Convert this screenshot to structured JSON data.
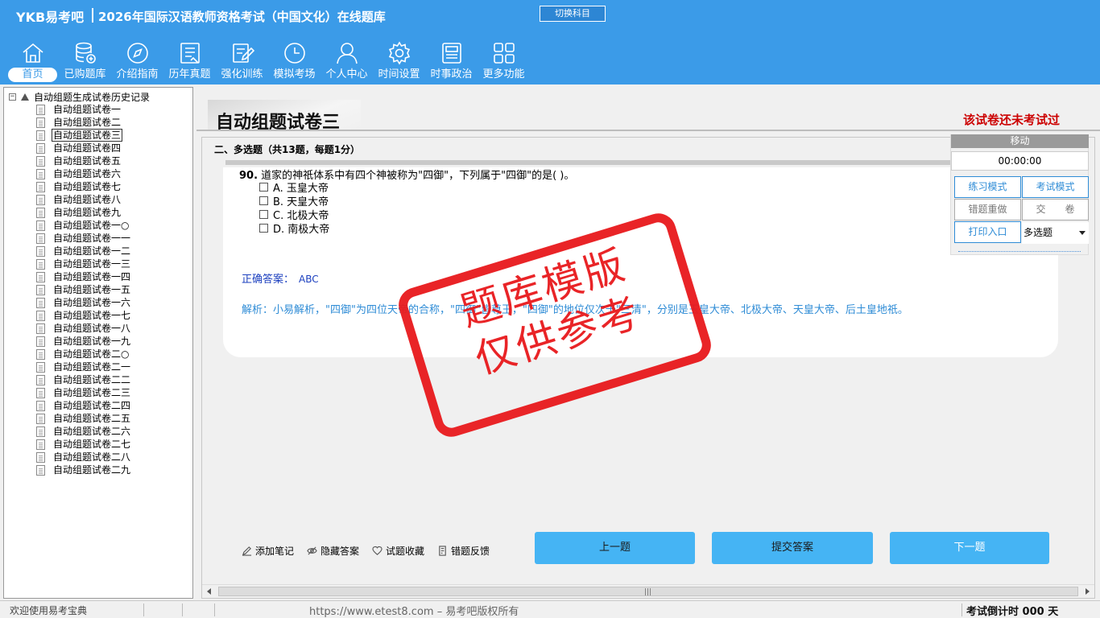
{
  "header": {
    "logo": "YKB易考吧",
    "title": "2026年国际汉语教师资格考试（中国文化）在线题库",
    "switch_subject": "切换科目"
  },
  "nav": [
    {
      "label": "首页",
      "icon": "home-icon",
      "active": true
    },
    {
      "label": "已购题库",
      "icon": "database-icon"
    },
    {
      "label": "介绍指南",
      "icon": "compass-icon"
    },
    {
      "label": "历年真题",
      "icon": "list-icon"
    },
    {
      "label": "强化训练",
      "icon": "edit-icon"
    },
    {
      "label": "模拟考场",
      "icon": "clock-icon"
    },
    {
      "label": "个人中心",
      "icon": "user-icon"
    },
    {
      "label": "时间设置",
      "icon": "gear-icon"
    },
    {
      "label": "时事政治",
      "icon": "news-icon"
    },
    {
      "label": "更多功能",
      "icon": "grid-icon"
    }
  ],
  "tree": {
    "root": "自动组题生成试卷历史记录",
    "expander": "−",
    "items": [
      "自动组题试卷一",
      "自动组题试卷二",
      "自动组题试卷三",
      "自动组题试卷四",
      "自动组题试卷五",
      "自动组题试卷六",
      "自动组题试卷七",
      "自动组题试卷八",
      "自动组题试卷九",
      "自动组题试卷一○",
      "自动组题试卷一一",
      "自动组题试卷一二",
      "自动组题试卷一三",
      "自动组题试卷一四",
      "自动组题试卷一五",
      "自动组题试卷一六",
      "自动组题试卷一七",
      "自动组题试卷一八",
      "自动组题试卷一九",
      "自动组题试卷二○",
      "自动组题试卷二一",
      "自动组题试卷二二",
      "自动组题试卷二三",
      "自动组题试卷二四",
      "自动组题试卷二五",
      "自动组题试卷二六",
      "自动组题试卷二七",
      "自动组题试卷二八",
      "自动组题试卷二九"
    ],
    "selected_index": 2
  },
  "paper": {
    "title": "自动组题试卷三",
    "status": "该试卷还未考试过",
    "section": "二、多选题（共13题，每题1分）"
  },
  "question": {
    "number": "90.",
    "text": "道家的神祇体系中有四个神被称为\"四御\"，下列属于\"四御\"的是( )。",
    "options": [
      "A. 玉皇大帝",
      "B. 天皇大帝",
      "C. 北极大帝",
      "D. 南极大帝"
    ],
    "answer_label": "正确答案：",
    "answer": "ABC",
    "analysis": "解析：小易解析，\"四御\"为四位天帝的合称，\"四御\"皆尊王，\"四御\"的地位仅次于\"三清\"，分别是玉皇大帝、北极大帝、天皇大帝、后土皇地祇。"
  },
  "stamp": {
    "line1": "题库模版",
    "line2": "仅供参考"
  },
  "side_panel": {
    "move": "移动",
    "timer": "00:00:00",
    "practice_mode": "练习模式",
    "exam_mode": "考试模式",
    "redo_wrong": "错题重做",
    "submit_paper": "交　　卷",
    "print": "打印入口",
    "question_type": "多选题"
  },
  "toolbar": {
    "add_note": "添加笔记",
    "hide_answer": "隐藏答案",
    "favorite": "试题收藏",
    "feedback": "错题反馈",
    "prev": "上一题",
    "submit": "提交答案",
    "next": "下一题"
  },
  "status_bar": {
    "welcome": "欢迎使用易考宝典",
    "copyright": "https://www.etest8.com – 易考吧版权所有",
    "countdown": "考试倒计时 000 天"
  },
  "colors": {
    "header_bg": "#3b9be8",
    "button_blue": "#45b4f4",
    "stamp_red": "#e8191c",
    "status_red": "#cc0000"
  }
}
